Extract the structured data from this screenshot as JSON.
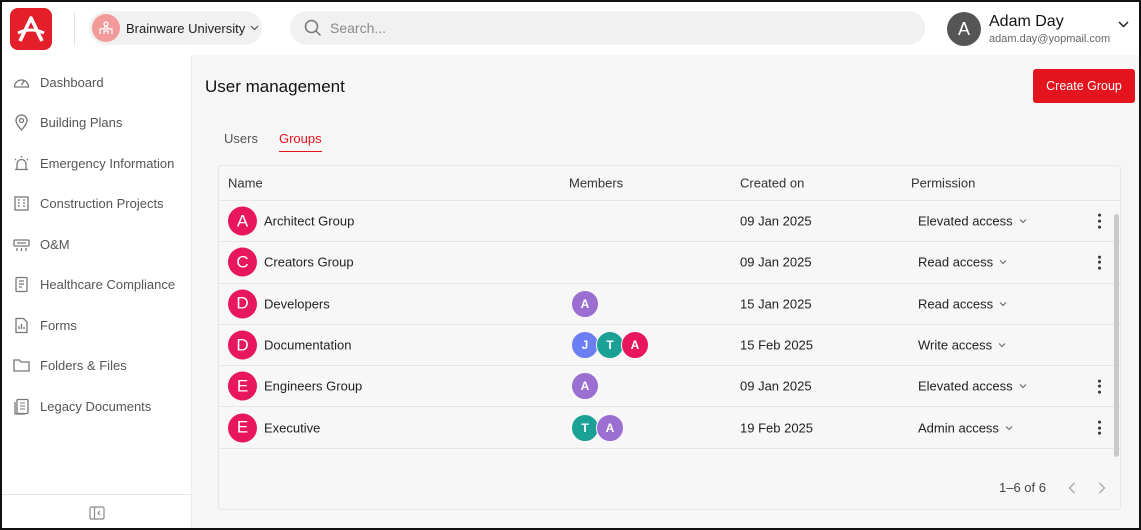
{
  "header": {
    "org_name": "Brainware University",
    "search_placeholder": "Search...",
    "user": {
      "initial": "A",
      "name": "Adam Day",
      "email": "adam.day@yopmail.com"
    }
  },
  "sidebar": {
    "items": [
      {
        "label": "Dashboard",
        "icon": "gauge-icon"
      },
      {
        "label": "Building Plans",
        "icon": "map-pin-icon"
      },
      {
        "label": "Emergency Information",
        "icon": "siren-icon"
      },
      {
        "label": "Construction Projects",
        "icon": "building-icon"
      },
      {
        "label": "O&M",
        "icon": "hvac-icon"
      },
      {
        "label": "Healthcare Compliance",
        "icon": "clipboard-icon"
      },
      {
        "label": "Forms",
        "icon": "form-icon"
      },
      {
        "label": "Folders & Files",
        "icon": "folder-icon"
      },
      {
        "label": "Legacy Documents",
        "icon": "documents-icon"
      }
    ]
  },
  "main": {
    "title": "User management",
    "create_label": "Create Group",
    "tabs": [
      {
        "label": "Users",
        "active": false
      },
      {
        "label": "Groups",
        "active": true
      }
    ],
    "table": {
      "headers": {
        "name": "Name",
        "members": "Members",
        "created": "Created on",
        "permission": "Permission"
      },
      "rows": [
        {
          "initial": "A",
          "name": "Architect Group",
          "members": [],
          "created": "09 Jan 2025",
          "permission": "Elevated access",
          "menu": true
        },
        {
          "initial": "C",
          "name": "Creators Group",
          "members": [],
          "created": "09 Jan 2025",
          "permission": "Read access",
          "menu": true
        },
        {
          "initial": "D",
          "name": "Developers",
          "members": [
            {
              "initial": "A",
              "color": "#9a6fd1"
            }
          ],
          "created": "15 Jan 2025",
          "permission": "Read access",
          "menu": false
        },
        {
          "initial": "D",
          "name": "Documentation",
          "members": [
            {
              "initial": "J",
              "color": "#6c7ff2"
            },
            {
              "initial": "T",
              "color": "#1aa095"
            },
            {
              "initial": "A",
              "color": "#e8165c"
            }
          ],
          "created": "15 Feb 2025",
          "permission": "Write access",
          "menu": false
        },
        {
          "initial": "E",
          "name": "Engineers Group",
          "members": [
            {
              "initial": "A",
              "color": "#9a6fd1"
            }
          ],
          "created": "09 Jan 2025",
          "permission": "Elevated access",
          "menu": true
        },
        {
          "initial": "E",
          "name": "Executive",
          "members": [
            {
              "initial": "T",
              "color": "#1aa095"
            },
            {
              "initial": "A",
              "color": "#9a6fd1"
            }
          ],
          "created": "19 Feb 2025",
          "permission": "Admin access",
          "menu": true
        }
      ]
    },
    "pagination": {
      "range": "1–6 of 6"
    }
  },
  "colors": {
    "brand_red": "#e3141d",
    "row_avatar": "#e8165c"
  }
}
